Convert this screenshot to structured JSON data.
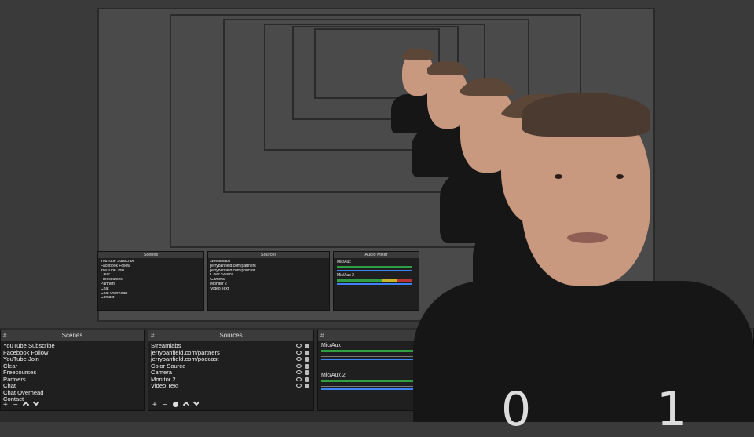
{
  "scenes": {
    "header": "Scenes",
    "items": [
      "YouTube Subscribe",
      "Facebook Follow",
      "YouTube Join",
      "Clear",
      "Freecourses",
      "Partners",
      "Chat",
      "Chat Overhead",
      "Contact"
    ]
  },
  "sources": {
    "header": "Sources",
    "items": [
      "Streamlabs",
      "jerrybanfield.com/partners",
      "jerrybanfield.com/podcast",
      "Color Source",
      "Camera",
      "Monitor 2",
      "Video Text"
    ]
  },
  "mixer": {
    "header": "Audio Mixer",
    "channels": [
      "Mic/Aux",
      "Mic/Aux 2"
    ]
  },
  "toolbar": {
    "add": "+",
    "remove": "−"
  },
  "shirt_digits": {
    "left": "0",
    "right": "1"
  },
  "colors": {
    "meter_green": "#2ea043",
    "background": "#3a3a3a"
  }
}
